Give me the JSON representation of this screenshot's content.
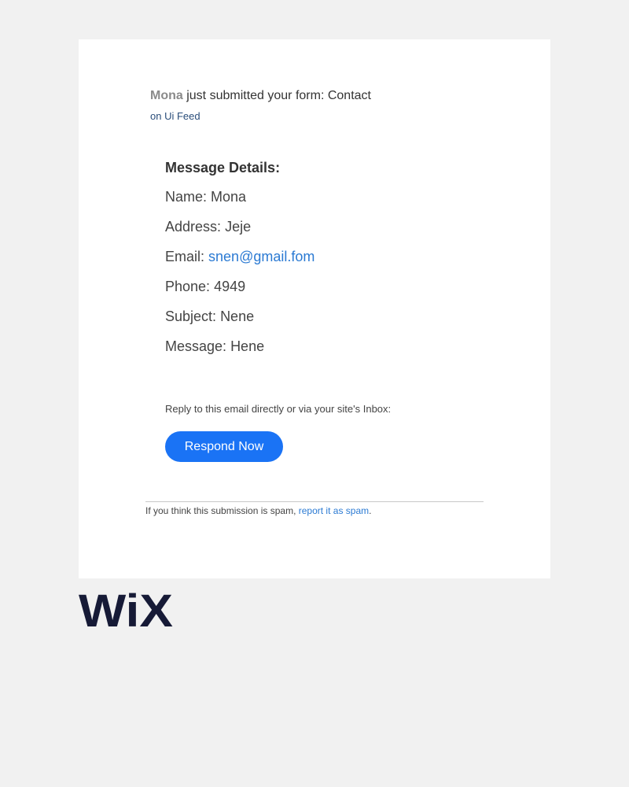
{
  "header": {
    "sender_name": "Mona",
    "action_text": " just submitted your form: Contact",
    "site_line": "on Ui Feed"
  },
  "details": {
    "title": "Message Details:",
    "rows": [
      {
        "label": "Name:",
        "value": "Mona"
      },
      {
        "label": "Address:",
        "value": "Jeje"
      },
      {
        "label": "Email:",
        "value": "snen@gmail.fom"
      },
      {
        "label": "Phone:",
        "value": "4949"
      },
      {
        "label": "Subject:",
        "value": "Nene"
      },
      {
        "label": "Message:",
        "value": "Hene"
      }
    ]
  },
  "reply": {
    "text": "Reply to this email directly or via your site's Inbox:",
    "button_label": "Respond Now"
  },
  "footer": {
    "spam_prefix": "If you think this submission is spam, ",
    "spam_link": "report it as spam",
    "spam_suffix": "."
  },
  "brand": {
    "logo_text": "WiX",
    "logo_color": "#161a36"
  },
  "colors": {
    "accent": "#1a73f5",
    "link": "#2b7ad3",
    "background": "#f1f1f1",
    "card": "#ffffff"
  }
}
